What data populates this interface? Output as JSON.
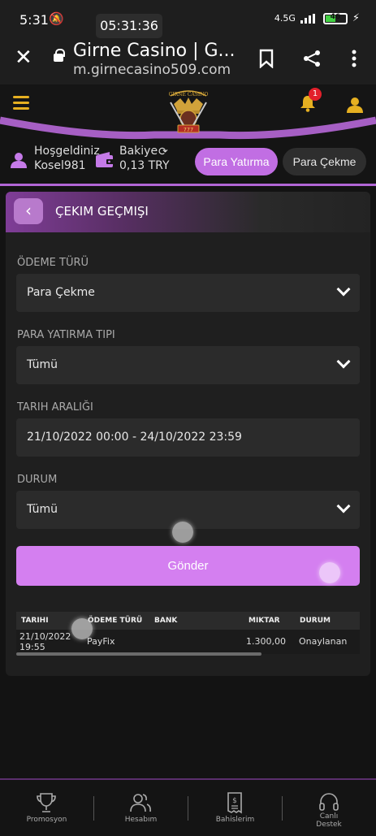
{
  "status_bar": {
    "time": "5:31",
    "clock_pill": "05:31:36",
    "network": "4.5G",
    "battery": "46"
  },
  "browser": {
    "title": "Girne Casino | G...",
    "url": "m.girnecasino509.com"
  },
  "header": {
    "notification_count": "1"
  },
  "account": {
    "welcome": "Hoşgeldiniz",
    "username": "Kosel981",
    "balance_label": "Bakiye",
    "balance_value": "0,13 TRY",
    "deposit_button": "Para Yatırma",
    "withdraw_button": "Para Çekme"
  },
  "panel": {
    "title": "ÇEKIM GEÇMIŞI",
    "fields": [
      {
        "label": "ÖDEME TÜRÜ",
        "value": "Para Çekme"
      },
      {
        "label": "PARA YATIRMA TIPI",
        "value": "Tümü"
      },
      {
        "label": "TARIH ARALIĞI",
        "value": "21/10/2022 00:00 - 24/10/2022 23:59"
      },
      {
        "label": "DURUM",
        "value": "Tümü"
      }
    ],
    "submit": "Gönder"
  },
  "table": {
    "headers": [
      "TARIHI",
      "ÖDEME TÜRÜ",
      "BANK",
      "MIKTAR",
      "DURUM"
    ],
    "rows": [
      {
        "date": "21/10/2022",
        "time": "19:55",
        "type": "PayFix",
        "bank": "",
        "amount": "1.300,00",
        "status": "Onaylanan"
      }
    ]
  },
  "bottom_nav": [
    {
      "label": "Promosyon",
      "icon": "trophy-icon"
    },
    {
      "label": "Hesabım",
      "icon": "users-icon"
    },
    {
      "label": "Bahislerim",
      "icon": "receipt-icon"
    },
    {
      "label": "Canlı Destek",
      "icon": "headset-icon"
    }
  ],
  "colors": {
    "accent": "#c16ee3",
    "gold": "#e6b021"
  }
}
